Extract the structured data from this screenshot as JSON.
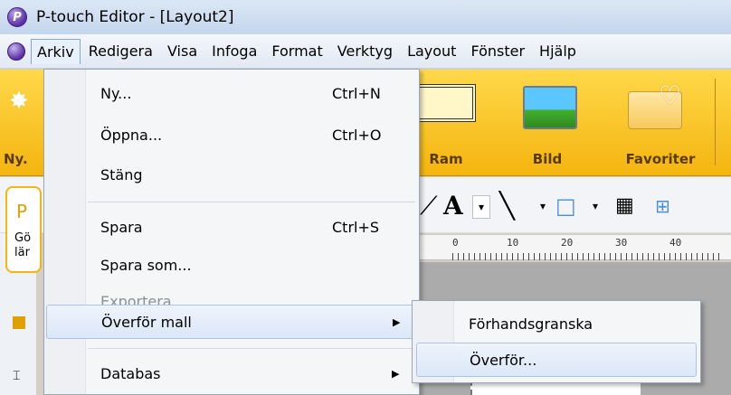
{
  "window": {
    "title": "P-touch Editor - [Layout2]"
  },
  "menubar": {
    "items": [
      "Arkiv",
      "Redigera",
      "Visa",
      "Infoga",
      "Format",
      "Verktyg",
      "Layout",
      "Fönster",
      "Hjälp"
    ],
    "active": "Arkiv"
  },
  "ribbon": {
    "buttons": [
      {
        "label": "Ny...",
        "icon": "new-layout-icon"
      },
      {
        "label": "Ram",
        "icon": "frame-icon"
      },
      {
        "label": "Bild",
        "icon": "picture-icon"
      },
      {
        "label": "Favoriter",
        "icon": "favorites-icon"
      }
    ],
    "visible_fragments": {
      "ny": "Ny."
    }
  },
  "left_panel": {
    "card_letter": "P",
    "card_text": [
      "Gö",
      "lär"
    ]
  },
  "ruler": {
    "numbers": [
      "0",
      "10",
      "20",
      "30",
      "40"
    ]
  },
  "file_menu": {
    "items": [
      {
        "label": "Ny...",
        "shortcut": "Ctrl+N"
      },
      {
        "label": "Öppna...",
        "shortcut": "Ctrl+O"
      },
      {
        "label": "Stäng",
        "shortcut": ""
      },
      {
        "label": "Spara",
        "shortcut": "Ctrl+S"
      },
      {
        "label": "Spara som...",
        "shortcut": ""
      },
      {
        "label": "Exportera...",
        "shortcut": "",
        "disabled": true
      },
      {
        "label": "Överför mall",
        "shortcut": "",
        "submenu": true,
        "highlighted": true
      },
      {
        "label": "Databas",
        "shortcut": "",
        "submenu": true
      }
    ]
  },
  "submenu": {
    "items": [
      {
        "label": "Förhandsgranska"
      },
      {
        "label": "Överför...",
        "highlighted": true
      }
    ]
  },
  "colors": {
    "ribbon_top": "#ffd84a",
    "ribbon_bottom": "#f4b50f",
    "menu_highlight": "#dbe7f7",
    "title_bar": "#c4d6ec"
  }
}
